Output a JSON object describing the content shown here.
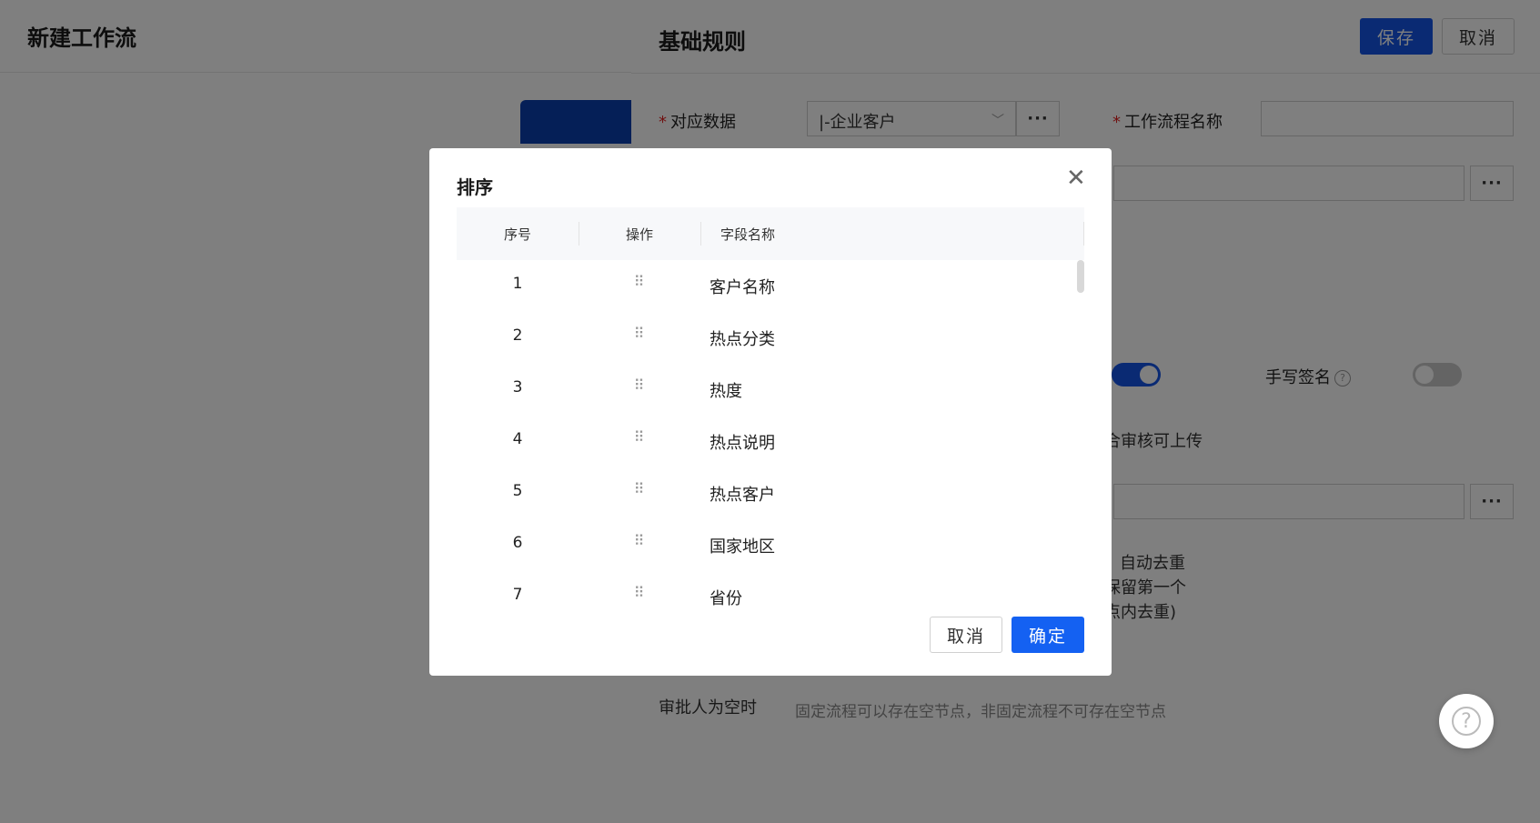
{
  "left": {
    "title": "新建工作流"
  },
  "right": {
    "title": "基础规则",
    "save_label": "保存",
    "cancel_label": "取消",
    "data_label": "对应数据",
    "data_value": "|-企业客户",
    "workflow_name_label": "工作流程名称",
    "signature_label": "手写签名",
    "partial_text_1": "合审核可上传",
    "dedupe_line1": "自动去重",
    "dedupe_line2": "保留第一个",
    "dedupe_line3": "点内去重)",
    "approver_empty_label": "审批人为空时",
    "approver_empty_hint": "固定流程可以存在空节点，非固定流程不可存在空节点",
    "more_dots": "···"
  },
  "modal": {
    "title": "排序",
    "columns": [
      "序号",
      "操作",
      "字段名称"
    ],
    "rows": [
      {
        "index": "1",
        "name": "客户名称"
      },
      {
        "index": "2",
        "name": "热点分类"
      },
      {
        "index": "3",
        "name": "热度"
      },
      {
        "index": "4",
        "name": "热点说明"
      },
      {
        "index": "5",
        "name": "热点客户"
      },
      {
        "index": "6",
        "name": "国家地区"
      },
      {
        "index": "7",
        "name": "省份"
      }
    ],
    "cancel_label": "取消",
    "ok_label": "确定"
  },
  "colors": {
    "primary": "#1455e6",
    "confirm": "#1461f2",
    "required": "#e02020"
  },
  "icons": {
    "drag": "drag-handle-icon",
    "close": "close-icon",
    "chevron": "chevron-down-icon",
    "help": "help-circle-icon"
  }
}
